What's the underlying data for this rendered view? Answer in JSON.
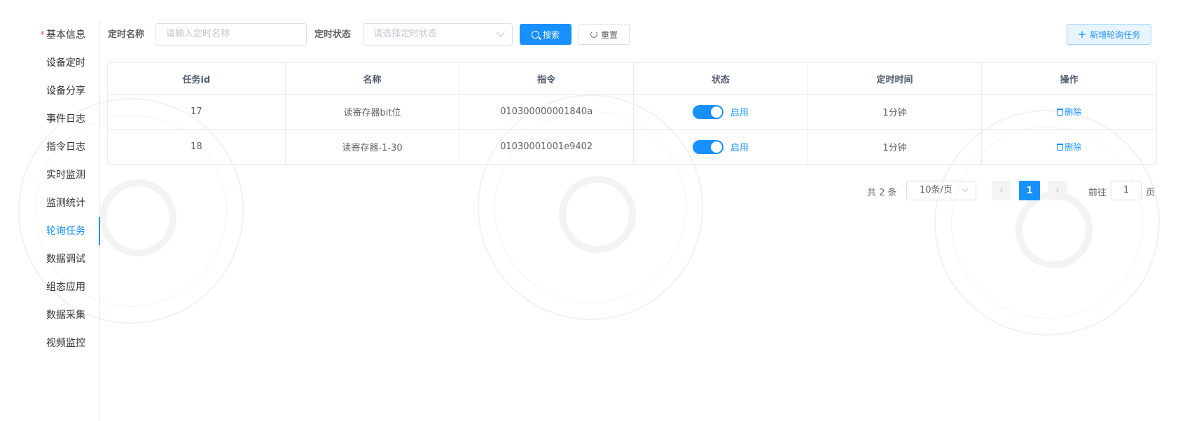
{
  "sidebar": {
    "items": [
      {
        "label": "基本信息",
        "required": "*"
      },
      {
        "label": "设备定时"
      },
      {
        "label": "设备分享"
      },
      {
        "label": "事件日志"
      },
      {
        "label": "指令日志"
      },
      {
        "label": "实时监测"
      },
      {
        "label": "监测统计"
      },
      {
        "label": "轮询任务",
        "active": true
      },
      {
        "label": "数据调试"
      },
      {
        "label": "组态应用"
      },
      {
        "label": "数据采集"
      },
      {
        "label": "视频监控"
      }
    ]
  },
  "filters": {
    "name_label": "定时名称",
    "name_placeholder": "请输入定时名称",
    "status_label": "定时状态",
    "status_placeholder": "请选择定时状态",
    "search_label": "搜索",
    "reset_label": "重置",
    "add_label": "新增轮询任务"
  },
  "table": {
    "headers": [
      "任务id",
      "名称",
      "指令",
      "状态",
      "定时时间",
      "操作"
    ],
    "rows": [
      {
        "id": "17",
        "name": "读寄存器bit位",
        "command": "010300000001840a",
        "status": "启用",
        "interval": "1分钟",
        "action": "删除"
      },
      {
        "id": "18",
        "name": "读寄存器-1-30",
        "command": "01030001001e9402",
        "status": "启用",
        "interval": "1分钟",
        "action": "删除"
      }
    ]
  },
  "pagination": {
    "total": "共 2 条",
    "page_size": "10条/页",
    "current_page": "1",
    "goto_prefix": "前往",
    "goto_value": "1",
    "goto_suffix": "页",
    "prev_icon": "‹",
    "next_icon": "›"
  },
  "colors": {
    "primary": "#1890ff",
    "border": "#dcdfe6",
    "text": "#606266"
  }
}
